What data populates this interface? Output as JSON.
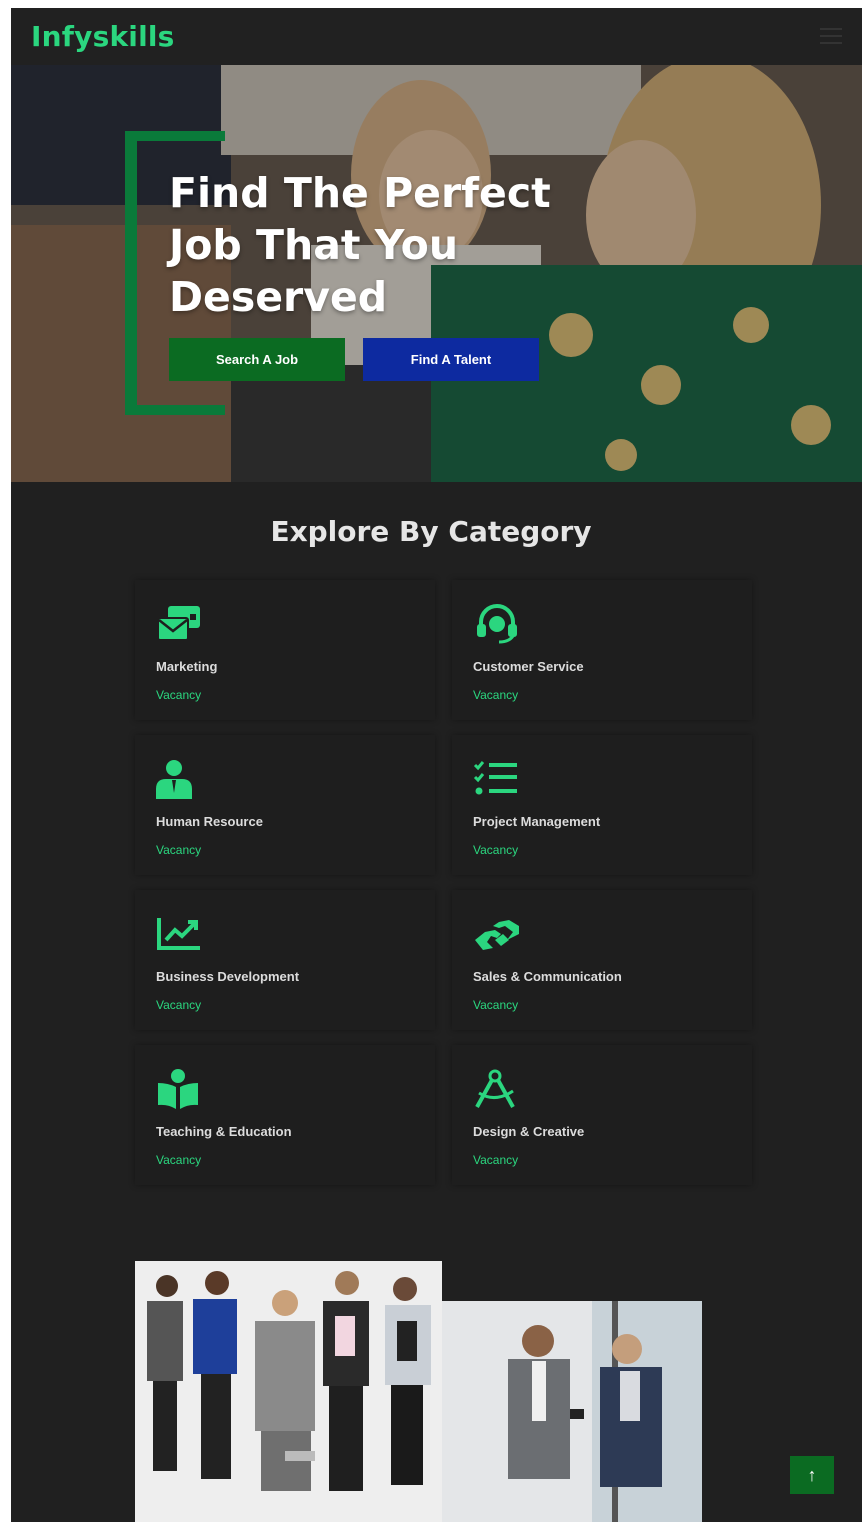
{
  "header": {
    "logo": "Infyskills",
    "menu_icon": "hamburger-icon"
  },
  "hero": {
    "title": "Find The Perfect\nJob That You\nDeserved",
    "buttons": {
      "search": "Search A Job",
      "talent": "Find A Talent"
    },
    "colors": {
      "accent_green": "#0a7a3a",
      "search_bg": "#0b6b22",
      "talent_bg": "#0d2aa0"
    }
  },
  "categories": {
    "title": "Explore By Category",
    "items": [
      {
        "icon": "envelope-cards-icon",
        "name": "Marketing",
        "vacancy": "Vacancy"
      },
      {
        "icon": "headset-icon",
        "name": "Customer Service",
        "vacancy": "Vacancy"
      },
      {
        "icon": "user-tie-icon",
        "name": "Human Resource",
        "vacancy": "Vacancy"
      },
      {
        "icon": "task-list-icon",
        "name": "Project Management",
        "vacancy": "Vacancy"
      },
      {
        "icon": "chart-line-icon",
        "name": "Business Development",
        "vacancy": "Vacancy"
      },
      {
        "icon": "handshake-icon",
        "name": "Sales & Communication",
        "vacancy": "Vacancy"
      },
      {
        "icon": "book-reader-icon",
        "name": "Teaching & Education",
        "vacancy": "Vacancy"
      },
      {
        "icon": "drafting-compass-icon",
        "name": "Design & Creative",
        "vacancy": "Vacancy"
      }
    ]
  },
  "footer_images": [
    "team-photo",
    "meeting-photo"
  ],
  "back_to_top": {
    "icon": "arrow-up-icon",
    "label": "↑"
  },
  "theme": {
    "brand_green": "#2bd67f",
    "bg": "#202020",
    "card": "#1e1e1e"
  }
}
